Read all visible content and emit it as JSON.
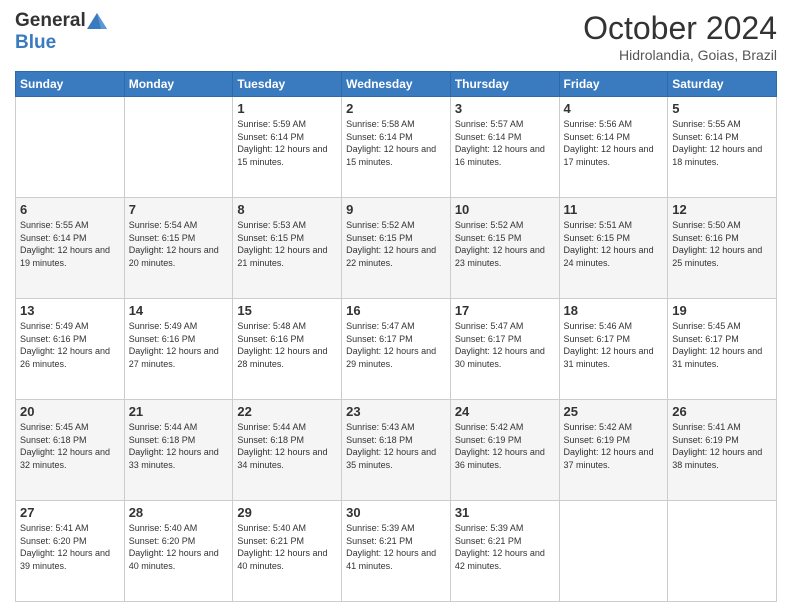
{
  "header": {
    "logo_general": "General",
    "logo_blue": "Blue",
    "month_title": "October 2024",
    "location": "Hidrolandia, Goias, Brazil"
  },
  "days_of_week": [
    "Sunday",
    "Monday",
    "Tuesday",
    "Wednesday",
    "Thursday",
    "Friday",
    "Saturday"
  ],
  "weeks": [
    [
      {
        "day": "",
        "info": ""
      },
      {
        "day": "",
        "info": ""
      },
      {
        "day": "1",
        "info": "Sunrise: 5:59 AM\nSunset: 6:14 PM\nDaylight: 12 hours and 15 minutes."
      },
      {
        "day": "2",
        "info": "Sunrise: 5:58 AM\nSunset: 6:14 PM\nDaylight: 12 hours and 15 minutes."
      },
      {
        "day": "3",
        "info": "Sunrise: 5:57 AM\nSunset: 6:14 PM\nDaylight: 12 hours and 16 minutes."
      },
      {
        "day": "4",
        "info": "Sunrise: 5:56 AM\nSunset: 6:14 PM\nDaylight: 12 hours and 17 minutes."
      },
      {
        "day": "5",
        "info": "Sunrise: 5:55 AM\nSunset: 6:14 PM\nDaylight: 12 hours and 18 minutes."
      }
    ],
    [
      {
        "day": "6",
        "info": "Sunrise: 5:55 AM\nSunset: 6:14 PM\nDaylight: 12 hours and 19 minutes."
      },
      {
        "day": "7",
        "info": "Sunrise: 5:54 AM\nSunset: 6:15 PM\nDaylight: 12 hours and 20 minutes."
      },
      {
        "day": "8",
        "info": "Sunrise: 5:53 AM\nSunset: 6:15 PM\nDaylight: 12 hours and 21 minutes."
      },
      {
        "day": "9",
        "info": "Sunrise: 5:52 AM\nSunset: 6:15 PM\nDaylight: 12 hours and 22 minutes."
      },
      {
        "day": "10",
        "info": "Sunrise: 5:52 AM\nSunset: 6:15 PM\nDaylight: 12 hours and 23 minutes."
      },
      {
        "day": "11",
        "info": "Sunrise: 5:51 AM\nSunset: 6:15 PM\nDaylight: 12 hours and 24 minutes."
      },
      {
        "day": "12",
        "info": "Sunrise: 5:50 AM\nSunset: 6:16 PM\nDaylight: 12 hours and 25 minutes."
      }
    ],
    [
      {
        "day": "13",
        "info": "Sunrise: 5:49 AM\nSunset: 6:16 PM\nDaylight: 12 hours and 26 minutes."
      },
      {
        "day": "14",
        "info": "Sunrise: 5:49 AM\nSunset: 6:16 PM\nDaylight: 12 hours and 27 minutes."
      },
      {
        "day": "15",
        "info": "Sunrise: 5:48 AM\nSunset: 6:16 PM\nDaylight: 12 hours and 28 minutes."
      },
      {
        "day": "16",
        "info": "Sunrise: 5:47 AM\nSunset: 6:17 PM\nDaylight: 12 hours and 29 minutes."
      },
      {
        "day": "17",
        "info": "Sunrise: 5:47 AM\nSunset: 6:17 PM\nDaylight: 12 hours and 30 minutes."
      },
      {
        "day": "18",
        "info": "Sunrise: 5:46 AM\nSunset: 6:17 PM\nDaylight: 12 hours and 31 minutes."
      },
      {
        "day": "19",
        "info": "Sunrise: 5:45 AM\nSunset: 6:17 PM\nDaylight: 12 hours and 31 minutes."
      }
    ],
    [
      {
        "day": "20",
        "info": "Sunrise: 5:45 AM\nSunset: 6:18 PM\nDaylight: 12 hours and 32 minutes."
      },
      {
        "day": "21",
        "info": "Sunrise: 5:44 AM\nSunset: 6:18 PM\nDaylight: 12 hours and 33 minutes."
      },
      {
        "day": "22",
        "info": "Sunrise: 5:44 AM\nSunset: 6:18 PM\nDaylight: 12 hours and 34 minutes."
      },
      {
        "day": "23",
        "info": "Sunrise: 5:43 AM\nSunset: 6:18 PM\nDaylight: 12 hours and 35 minutes."
      },
      {
        "day": "24",
        "info": "Sunrise: 5:42 AM\nSunset: 6:19 PM\nDaylight: 12 hours and 36 minutes."
      },
      {
        "day": "25",
        "info": "Sunrise: 5:42 AM\nSunset: 6:19 PM\nDaylight: 12 hours and 37 minutes."
      },
      {
        "day": "26",
        "info": "Sunrise: 5:41 AM\nSunset: 6:19 PM\nDaylight: 12 hours and 38 minutes."
      }
    ],
    [
      {
        "day": "27",
        "info": "Sunrise: 5:41 AM\nSunset: 6:20 PM\nDaylight: 12 hours and 39 minutes."
      },
      {
        "day": "28",
        "info": "Sunrise: 5:40 AM\nSunset: 6:20 PM\nDaylight: 12 hours and 40 minutes."
      },
      {
        "day": "29",
        "info": "Sunrise: 5:40 AM\nSunset: 6:21 PM\nDaylight: 12 hours and 40 minutes."
      },
      {
        "day": "30",
        "info": "Sunrise: 5:39 AM\nSunset: 6:21 PM\nDaylight: 12 hours and 41 minutes."
      },
      {
        "day": "31",
        "info": "Sunrise: 5:39 AM\nSunset: 6:21 PM\nDaylight: 12 hours and 42 minutes."
      },
      {
        "day": "",
        "info": ""
      },
      {
        "day": "",
        "info": ""
      }
    ]
  ]
}
